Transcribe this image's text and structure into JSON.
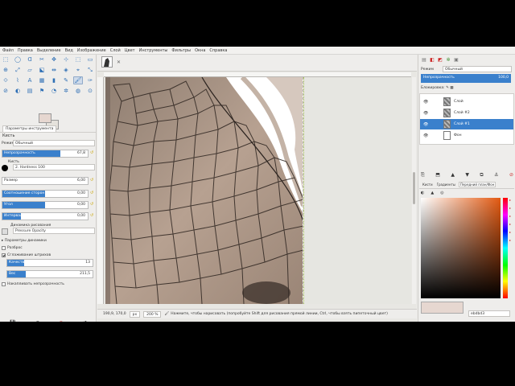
{
  "menu": [
    "Файл",
    "Правка",
    "Выделение",
    "Вид",
    "Изображение",
    "Слой",
    "Цвет",
    "Инструменты",
    "Фильтры",
    "Окна",
    "Справка"
  ],
  "toolbox": {
    "tool_icons": [
      "⬚",
      "◯",
      "ᗡ",
      "✂",
      "✥",
      "⊹",
      "⬚",
      "▭",
      "⊕",
      "⤢",
      "▱",
      "⬕",
      "⇹",
      "◈",
      "⌖",
      "⤡",
      "⟐",
      "⌇",
      "A",
      "▦",
      "▮",
      "✎",
      "🖌",
      "✑",
      "⊘",
      "◐",
      "▤",
      "⚑",
      "◔",
      "✲",
      "◍",
      "⊙"
    ],
    "options_tab": "Параметры инструмента",
    "tool_title": "Кисть",
    "mode_label": "Режим",
    "mode_value": "Обычный",
    "opacity_label": "Непрозрачность",
    "opacity_value": "67,8",
    "opacity_fraction": 0.678,
    "brush_label": "Кисть",
    "brush_value": "2. Hardness 100",
    "size_label": "Размер",
    "size_value": "6,00",
    "aspect_label": "Соотношение сторон",
    "aspect_value": "0,00",
    "angle_label": "Угол",
    "angle_value": "0,00",
    "spacing_label": "Интервал",
    "spacing_value": "0,00",
    "dynamics_label": "Динамика рисования",
    "dynamics_value": "Pressure Opacity",
    "dynamics_params": "Параметры динамики",
    "jitter": "Разброс",
    "smooth": "Сглаживание штрихов",
    "quality_label": "Качество",
    "quality_value": "13",
    "weight_label": "Вес",
    "weight_value": "211,5",
    "incremental": "Накапливать непрозрачность",
    "bottom_icons": [
      "💾",
      "↶",
      "⊘",
      "↺"
    ]
  },
  "canvas": {
    "status_coords": "190,9, 170,0",
    "status_units": "px",
    "zoom": "200 %",
    "status_message": "Нажмите, чтобы нарисовать (попробуйте Shift для рисования прямой линии, Ctrl, чтобы взять пипеточный цвет)"
  },
  "layers_panel": {
    "mode_label": "Режим",
    "mode_value": "Обычный",
    "opacity_label": "Непрозрачность",
    "opacity_value": "100,0",
    "lock_label": "Блокировка:",
    "layers": [
      {
        "name": "Слой",
        "selected": false
      },
      {
        "name": "Слой #2",
        "selected": false
      },
      {
        "name": "Слой #1",
        "selected": true
      },
      {
        "name": "Фон",
        "selected": false
      }
    ],
    "buttons": [
      "⎘",
      "⬒",
      "▲",
      "▼",
      "⧉",
      "⚓",
      "⊘"
    ]
  },
  "colors": {
    "tabs": [
      "Кисти",
      "Градиенты",
      "Передний план/Фон"
    ],
    "hex_value": "ebdbd3",
    "fg_color": "#e6d7d0"
  }
}
